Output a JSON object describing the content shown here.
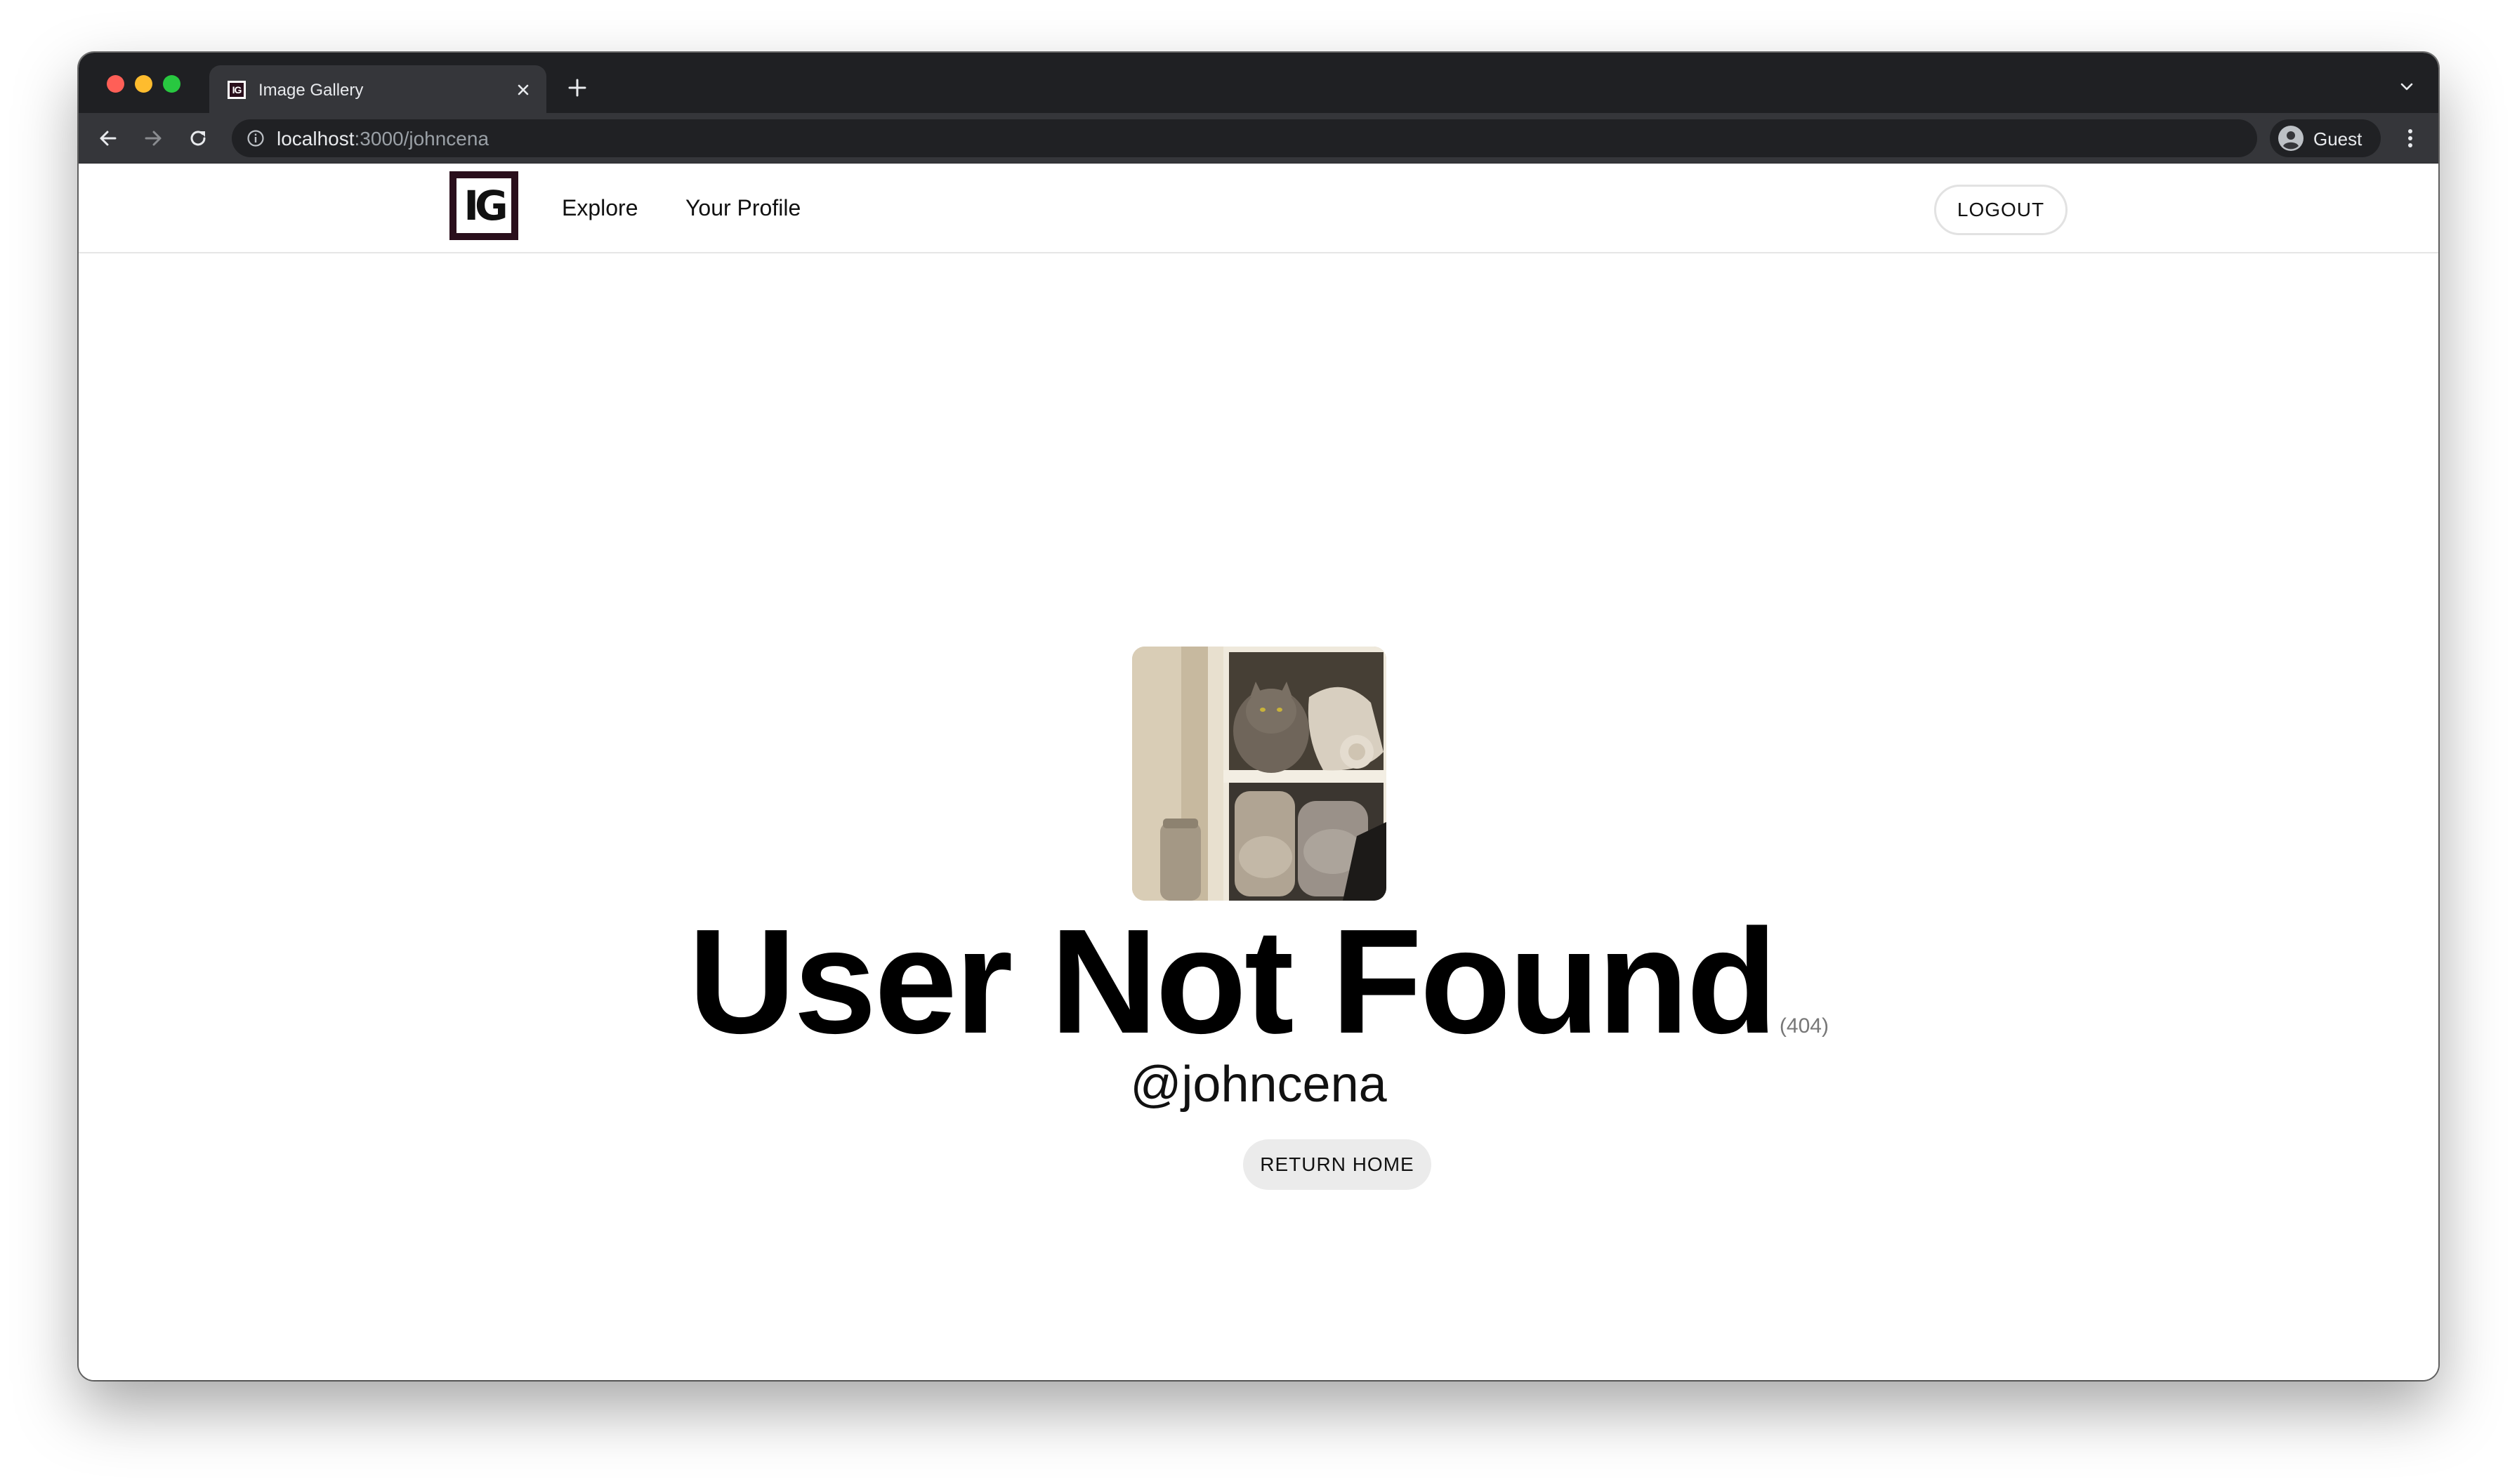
{
  "browser": {
    "tab": {
      "title": "Image Gallery",
      "favicon_text": "IG"
    },
    "url": {
      "host": "localhost",
      "path": ":3000/johncena"
    },
    "profile_label": "Guest"
  },
  "site": {
    "logo_text": "IG",
    "nav": {
      "explore": "Explore",
      "your_profile": "Your Profile"
    },
    "logout_label": "LOGOUT"
  },
  "error": {
    "headline": "User Not Found",
    "status_code": "(404)",
    "handle": "@johncena",
    "return_home_label": "RETURN HOME"
  }
}
